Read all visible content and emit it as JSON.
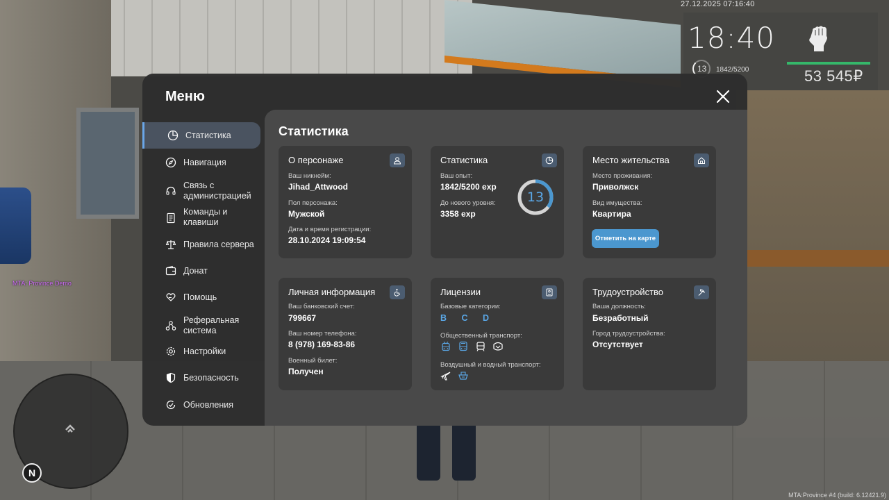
{
  "hud": {
    "datetime": "27.12.2025 07:16:40",
    "time": "18:40",
    "level": "13",
    "exp": "1842/5200",
    "money": "53 545₽",
    "server_tag": "MTA: Province Demo",
    "build_info": "MTA:Province #4 (build: 6.12421.9)",
    "compass": "N",
    "health_color": "#35b86a"
  },
  "menu": {
    "title": "Меню",
    "accent": "#5aa7e6",
    "sidebar": [
      {
        "label": "Статистика",
        "icon": "chart-icon",
        "active": true
      },
      {
        "label": "Навигация",
        "icon": "compass-icon"
      },
      {
        "label": "Связь с администрацией",
        "icon": "headset-icon"
      },
      {
        "label": "Команды и клавиши",
        "icon": "document-icon"
      },
      {
        "label": "Правила сервера",
        "icon": "scales-icon"
      },
      {
        "label": "Донат",
        "icon": "wallet-icon"
      },
      {
        "label": "Помощь",
        "icon": "heart-hand-icon"
      },
      {
        "label": "Реферальная система",
        "icon": "referral-icon"
      },
      {
        "label": "Настройки",
        "icon": "gear-icon"
      },
      {
        "label": "Безопасность",
        "icon": "shield-icon"
      },
      {
        "label": "Обновления",
        "icon": "refresh-icon"
      }
    ],
    "content_title": "Статистика",
    "cards": {
      "character": {
        "title": "О персонаже",
        "icon": "user-icon",
        "nickname_label": "Ваш никнейм:",
        "nickname": "Jihad_Attwood",
        "gender_label": "Пол персонажа:",
        "gender": "Мужской",
        "reg_label": "Дата и время регистрации:",
        "reg": "28.10.2024 19:09:54"
      },
      "stats": {
        "title": "Статистика",
        "icon": "chart-icon",
        "exp_label": "Ваш опыт:",
        "exp": "1842/5200 exp",
        "next_label": "До нового уровня:",
        "next": "3358 exp",
        "level": "13",
        "progress": 0.354
      },
      "residence": {
        "title": "Место жительства",
        "icon": "home-icon",
        "place_label": "Место проживания:",
        "place": "Приволжск",
        "type_label": "Вид имущества:",
        "type": "Квартира",
        "button": "Отметить на карте"
      },
      "personal": {
        "title": "Личная информация",
        "icon": "wheelchair-icon",
        "bank_label": "Ваш банковский счет:",
        "bank": "799667",
        "phone_label": "Ваш номер телефона:",
        "phone": "8 (978) 169-83-86",
        "military_label": "Военный билет:",
        "military": "Получен"
      },
      "licenses": {
        "title": "Лицензии",
        "icon": "id-card-icon",
        "basic_label": "Базовые категории:",
        "basic": "B C D",
        "public_label": "Общественный транспорт:",
        "public_icons": [
          "trolleybus-icon",
          "bus-icon",
          "tram-icon",
          "metro-icon"
        ],
        "air_label": "Воздушный и водный транспорт:",
        "air_icons": [
          "plane-icon",
          "boat-icon"
        ]
      },
      "employment": {
        "title": "Трудоустройство",
        "icon": "pickaxe-icon",
        "position_label": "Ваша должность:",
        "position": "Безработный",
        "city_label": "Город трудоустройства:",
        "city": "Отсутствует"
      }
    }
  }
}
